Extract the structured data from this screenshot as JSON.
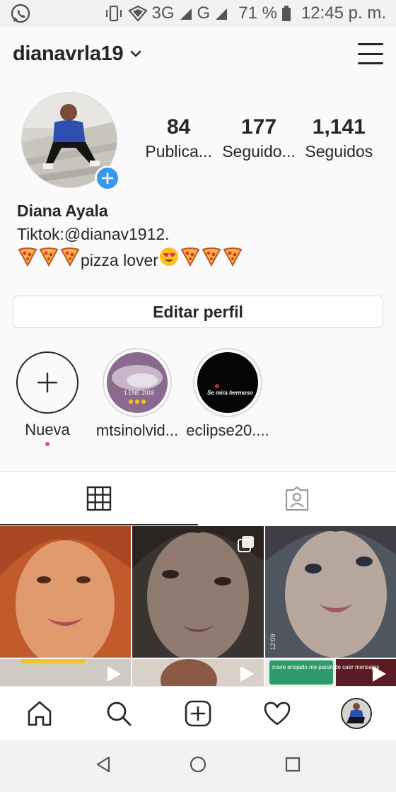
{
  "status_bar": {
    "whatsapp_icon": "whatsapp-icon",
    "network_3g": "3G",
    "network_g": "G",
    "battery_percent": "71 %",
    "time": "12:45 p. m."
  },
  "header": {
    "username": "dianavrla19",
    "menu_icon": "hamburger-menu-icon"
  },
  "profile": {
    "stats": [
      {
        "number": "84",
        "label": "Publica..."
      },
      {
        "number": "177",
        "label": "Seguido..."
      },
      {
        "number": "1,141",
        "label": "Seguidos"
      }
    ],
    "name": "Diana Ayala",
    "bio_line1": "Tiktok:@dianav1912.",
    "bio_line2_text": "pizza lover",
    "edit_profile_label": "Editar perfil"
  },
  "highlights": [
    {
      "label": "Nueva"
    },
    {
      "label": "mtsinolvid...",
      "caption": "1 ENE 2018"
    },
    {
      "label": "eclipse20....",
      "caption": "Se mira hermoso"
    }
  ],
  "tabs": {
    "grid_icon": "grid-icon",
    "tagged_icon": "tagged-person-icon"
  },
  "grid_items": {
    "text_overlay_6": "novio enojado me paran de caer mensajes",
    "timestamp_3": "12:09"
  },
  "bottom_nav": [
    "home-icon",
    "search-icon",
    "add-post-icon",
    "heart-icon",
    "profile-avatar"
  ],
  "system_nav": [
    "back-icon",
    "home-circle-icon",
    "recents-icon"
  ],
  "colors": {
    "accent_blue": "#3897f0",
    "notification_red": "#ed4956",
    "text_dark": "#262626",
    "border_gray": "#dbdbdb"
  }
}
